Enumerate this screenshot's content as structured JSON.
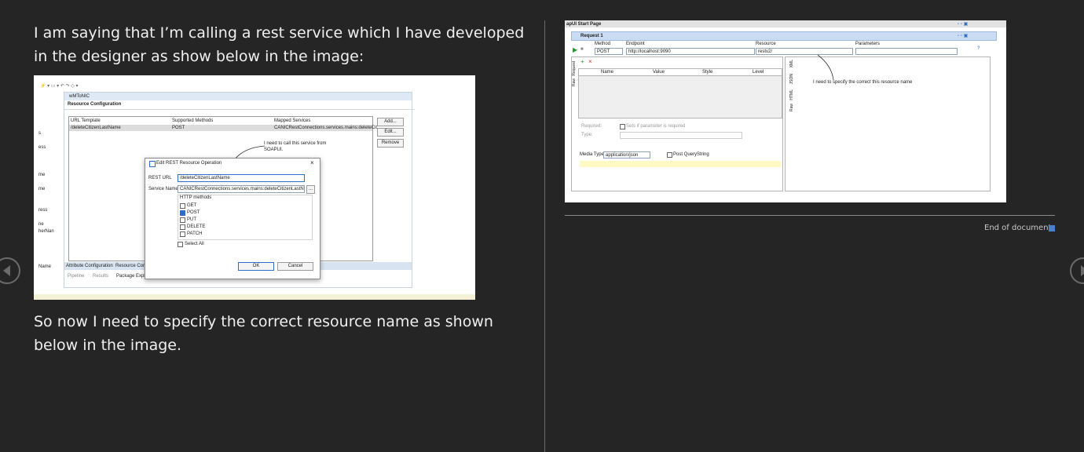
{
  "text": {
    "para1": "I am saying that I’m calling a rest service which I have developed in the designer as show below in the image:",
    "para2": "So now I need to specify the correct resource name as shown below in the image.",
    "end_of_document": "End of document"
  },
  "designer": {
    "tab_title": "wMToNIC",
    "section_title": "Resource Configuration",
    "headers": [
      "URL Template",
      "Supported Methods",
      "Mapped Services"
    ],
    "row": [
      "/deleteCitizenLastName",
      "POST",
      "CANICRestConnections.services.mains:deleteCit..."
    ],
    "buttons": [
      "Add...",
      "Edit...",
      "Remove"
    ],
    "annotation": "I need to call this service from SOAPUI.",
    "left_labels": [
      "s",
      "ess",
      "me",
      "me",
      "ress",
      "ne",
      "herNan",
      "Name"
    ],
    "dialog": {
      "title": "Edit REST Resource Operation",
      "rest_url_label": "REST URL",
      "rest_url_value": "/deleteCitizenLastName",
      "service_name_label": "Service Name",
      "service_name_value": "CANICRestConnections.services.mains:deleteCitizenLastName",
      "browse": "...",
      "http_methods_label": "HTTP methods",
      "methods": [
        "GET",
        "POST",
        "PUT",
        "DELETE",
        "PATCH"
      ],
      "select_all": "Select All",
      "ok": "OK",
      "cancel": "Cancel"
    },
    "bottom_tabs": [
      "Attribute Configuration",
      "Resource Confic"
    ],
    "bottom_views": [
      "Pipeline",
      "Results",
      "Package Explo"
    ]
  },
  "soapui": {
    "start_page": "apUI Start Page",
    "request_title": "Request 1",
    "method_label": "Method",
    "method_value": "POST",
    "endpoint_label": "Endpoint",
    "endpoint_value": "http://localhost:9090",
    "resource_label": "Resource",
    "resource_value": "restv2/",
    "parameters_label": "Parameters",
    "table_headers": [
      "Name",
      "Value",
      "Style",
      "Level"
    ],
    "side_tabs": [
      "Request",
      "Raw"
    ],
    "resp_tabs": [
      "XML",
      "JSON",
      "HTML",
      "Raw"
    ],
    "required_label": "Required:",
    "required_text": "Sets if parameter is required",
    "type_label": "Type:",
    "media_type_label": "Media Type",
    "media_type_value": "application/json",
    "post_querystring": "Post QueryString",
    "annotation": "I need to specify the correct this resource name"
  }
}
